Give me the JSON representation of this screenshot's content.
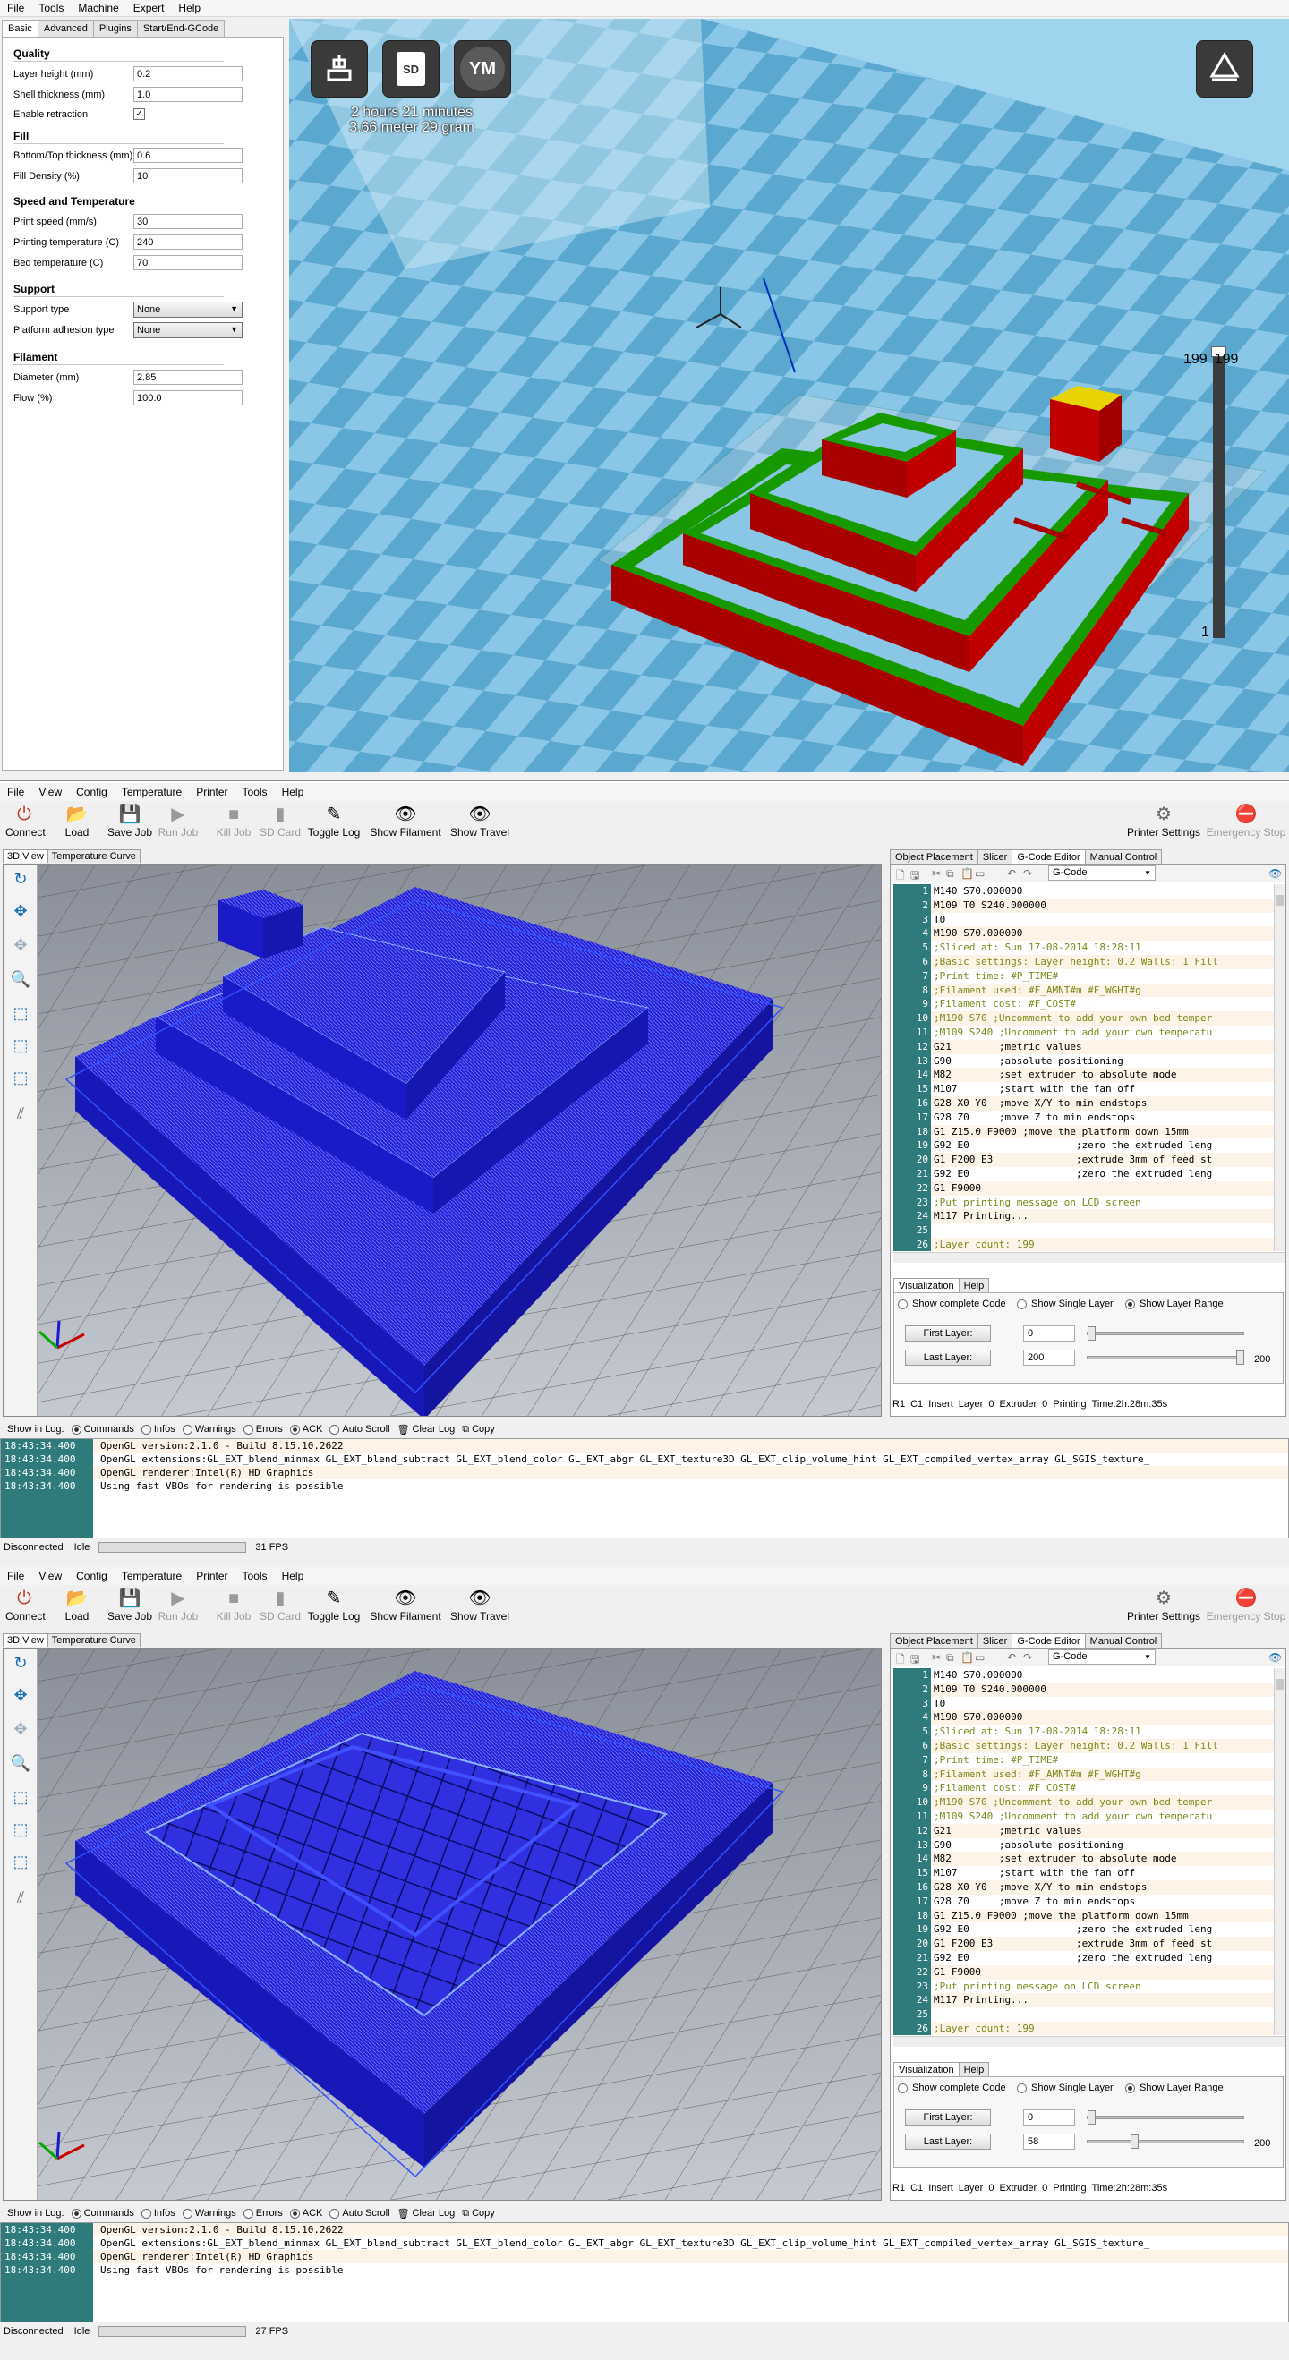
{
  "cura": {
    "menu": [
      "File",
      "Tools",
      "Machine",
      "Expert",
      "Help"
    ],
    "tabs": [
      "Basic",
      "Advanced",
      "Plugins",
      "Start/End-GCode"
    ],
    "sections": {
      "quality": "Quality",
      "fill": "Fill",
      "speed": "Speed and Temperature",
      "support": "Support",
      "filament": "Filament"
    },
    "fields": {
      "layer_height": {
        "label": "Layer height (mm)",
        "value": "0.2"
      },
      "shell_thickness": {
        "label": "Shell thickness (mm)",
        "value": "1.0"
      },
      "enable_retraction": {
        "label": "Enable retraction",
        "value": "✓"
      },
      "bottom_top": {
        "label": "Bottom/Top thickness (mm)",
        "value": "0.6"
      },
      "fill_density": {
        "label": "Fill Density (%)",
        "value": "10"
      },
      "print_speed": {
        "label": "Print speed (mm/s)",
        "value": "30"
      },
      "print_temp": {
        "label": "Printing temperature (C)",
        "value": "240"
      },
      "bed_temp": {
        "label": "Bed temperature (C)",
        "value": "70"
      },
      "support_type": {
        "label": "Support type",
        "value": "None"
      },
      "platform_adhesion": {
        "label": "Platform adhesion type",
        "value": "None"
      },
      "diameter": {
        "label": "Diameter (mm)",
        "value": "2.85"
      },
      "flow": {
        "label": "Flow (%)",
        "value": "100.0"
      }
    },
    "view": {
      "sd_label": "SD",
      "ym_label": "YM",
      "print_time": "2 hours 21 minutes",
      "print_material": "3.66 meter 29 gram",
      "layer_top": "199",
      "layer_top2": "199",
      "layer_bottom": "1"
    }
  },
  "repetier": [
    {
      "menu": [
        "File",
        "View",
        "Config",
        "Temperature",
        "Printer",
        "Tools",
        "Help"
      ],
      "toolbar": {
        "connect": "Connect",
        "load": "Load",
        "save_job": "Save Job",
        "run_job": "Run Job",
        "kill_job": "Kill Job",
        "sd_card": "SD Card",
        "toggle_log": "Toggle Log",
        "show_filament": "Show Filament",
        "show_travel": "Show Travel",
        "printer_settings": "Printer Settings",
        "emergency_stop": "Emergency Stop"
      },
      "view_tabs": [
        "3D View",
        "Temperature Curve"
      ],
      "right_tabs": [
        "Object Placement",
        "Slicer",
        "G-Code Editor",
        "Manual Control"
      ],
      "gcode_select": "G-Code",
      "code": [
        "M140 S70.000000",
        "M109 T0 S240.000000",
        "T0",
        "M190 S70.000000",
        ";Sliced at: Sun 17-08-2014 18:28:11",
        ";Basic settings: Layer height: 0.2 Walls: 1 Fill",
        ";Print time: #P_TIME#",
        ";Filament used: #F_AMNT#m #F_WGHT#g",
        ";Filament cost: #F_COST#",
        ";M190 S70 ;Uncomment to add your own bed temper",
        ";M109 S240 ;Uncomment to add your own temperatu",
        "G21        ;metric values",
        "G90        ;absolute positioning",
        "M82        ;set extruder to absolute mode",
        "M107       ;start with the fan off",
        "G28 X0 Y0  ;move X/Y to min endstops",
        "G28 Z0     ;move Z to min endstops",
        "G1 Z15.0 F9000 ;move the platform down 15mm",
        "G92 E0                  ;zero the extruded leng",
        "G1 F200 E3              ;extrude 3mm of feed st",
        "G92 E0                  ;zero the extruded leng",
        "G1 F9000",
        ";Put printing message on LCD screen",
        "M117 Printing...",
        "",
        ";Layer count: 199"
      ],
      "vis_tabs": [
        "Visualization",
        "Help"
      ],
      "vis": {
        "show_complete": "Show complete Code",
        "show_single": "Show Single Layer",
        "show_range": "Show Layer Range",
        "first_layer": "First Layer:",
        "first_value": "0",
        "last_layer": "Last Layer:",
        "last_value": "200",
        "slider_max": "200"
      },
      "editor_status": "R1  C1  Insert  Layer 0  Extruder 0  Printing Time:2h:28m:35s",
      "log_bar": {
        "show_in_log": "Show in Log:",
        "commands": "Commands",
        "infos": "Infos",
        "warnings": "Warnings",
        "errors": "Errors",
        "ack": "ACK",
        "auto_scroll": "Auto Scroll",
        "clear_log": "Clear Log",
        "copy": "Copy"
      },
      "log": [
        {
          "ts": "18:43:34.400",
          "msg": "OpenGL version:2.1.0 - Build 8.15.10.2622"
        },
        {
          "ts": "18:43:34.400",
          "msg": "OpenGL extensions:GL_EXT_blend_minmax GL_EXT_blend_subtract GL_EXT_blend_color GL_EXT_abgr GL_EXT_texture3D GL_EXT_clip_volume_hint GL_EXT_compiled_vertex_array GL_SGIS_texture_"
        },
        {
          "ts": "18:43:34.400",
          "msg": "OpenGL renderer:Intel(R) HD Graphics"
        },
        {
          "ts": "18:43:34.400",
          "msg": "Using fast VBOs for rendering is possible"
        }
      ],
      "status": {
        "connection": "Disconnected",
        "state": "Idle",
        "fps": "31 FPS"
      }
    },
    {
      "vis": {
        "last_value": "58",
        "slider_max": "200"
      },
      "status": {
        "connection": "Disconnected",
        "state": "Idle",
        "fps": "27 FPS"
      }
    }
  ],
  "colors": {
    "accent": "#2f7b7b",
    "bed_blue": "#5aa7cf",
    "model_red": "#a80000",
    "model_green": "#179a00",
    "gcode_blue": "#1f1fd6"
  }
}
